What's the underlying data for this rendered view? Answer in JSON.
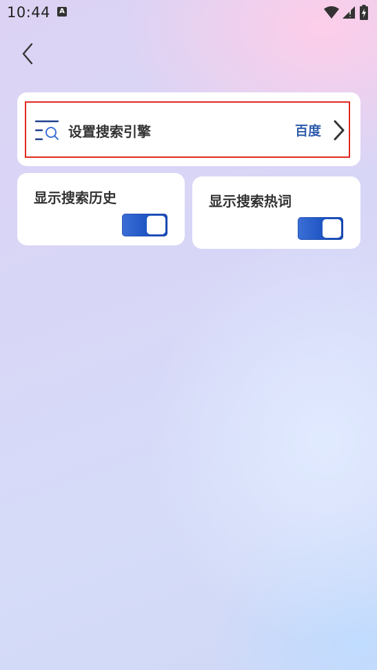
{
  "status_bar": {
    "time": "10:44",
    "notification_icon": "A",
    "icons": [
      "wifi-icon",
      "signal-icon",
      "battery-charging-icon"
    ]
  },
  "navigation": {
    "back_icon": "chevron-left-icon"
  },
  "search_engine": {
    "label": "设置搜索引擎",
    "value": "百度",
    "icon": "search-list-icon",
    "chevron_icon": "chevron-right-icon",
    "highlight_color": "#e0281f",
    "value_color": "#2f5dab"
  },
  "toggles": {
    "show_history": {
      "label": "显示搜索历史",
      "enabled": true
    },
    "show_hot_words": {
      "label": "显示搜索热词",
      "enabled": true
    },
    "accent_color": "#1f55c3"
  }
}
